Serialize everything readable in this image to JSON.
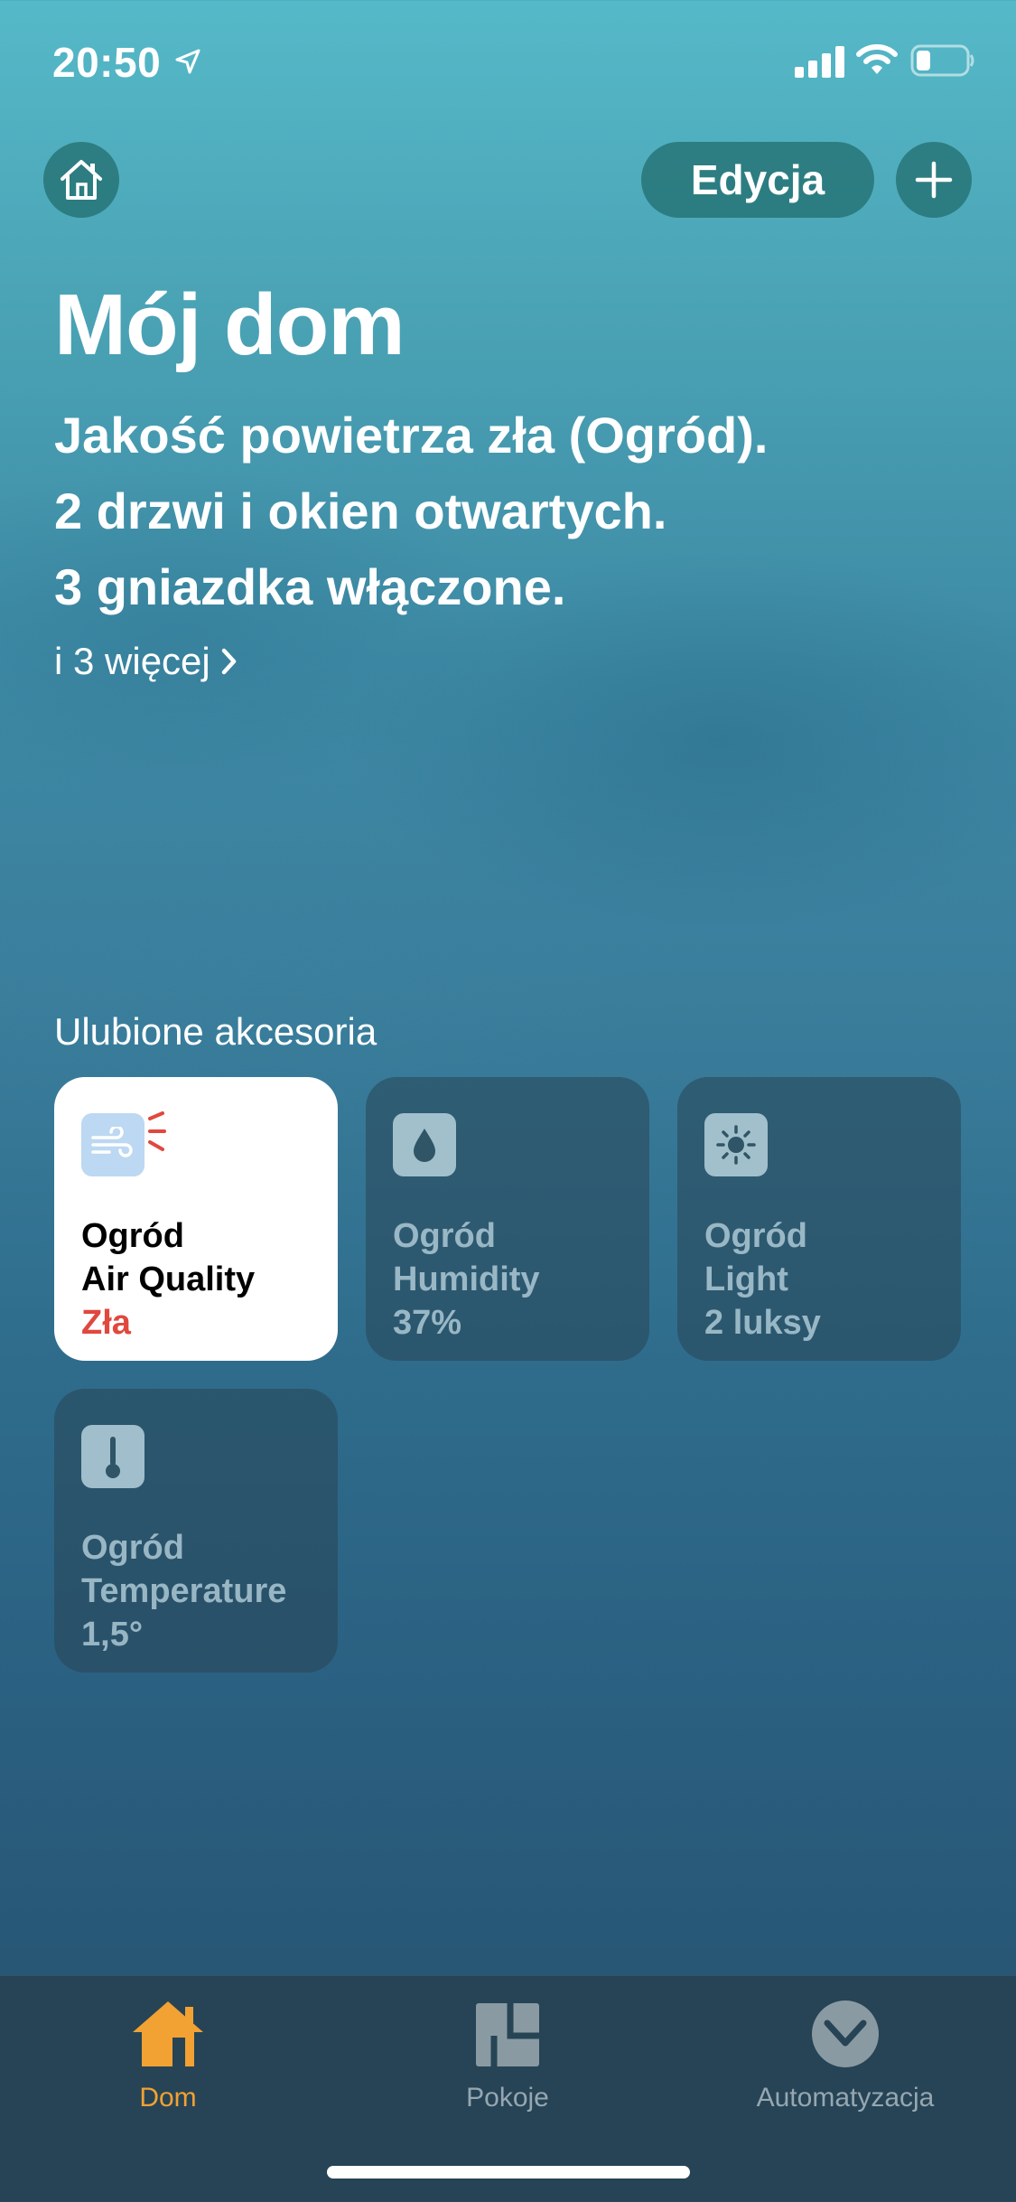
{
  "status_bar": {
    "time": "20:50",
    "icons": [
      "location-arrow-icon",
      "cellular-signal-icon",
      "wifi-icon",
      "battery-low-icon"
    ]
  },
  "header": {
    "home_icon": "house-icon",
    "edit_label": "Edycja",
    "add_icon": "plus-icon"
  },
  "title": "Mój dom",
  "summary": [
    "Jakość powietrza zła (Ogród).",
    "2 drzwi i okien otwartych.",
    "3 gniazdka włączone."
  ],
  "more_link": "i 3 więcej",
  "favorites": {
    "title": "Ulubione akcesoria",
    "tiles": [
      {
        "room": "Ogród",
        "name": "Air Quality",
        "status": "Zła",
        "icon": "wind-icon",
        "active": true
      },
      {
        "room": "Ogród",
        "name": "Humidity",
        "status": "37%",
        "icon": "droplet-icon",
        "active": false
      },
      {
        "room": "Ogród",
        "name": "Light",
        "status": "2 luksy",
        "icon": "sun-icon",
        "active": false
      },
      {
        "room": "Ogród",
        "name": "Temperature",
        "status": "1,5°",
        "icon": "thermometer-icon",
        "active": false
      }
    ]
  },
  "tabs": [
    {
      "label": "Dom",
      "icon": "house-fill-icon",
      "selected": true
    },
    {
      "label": "Pokoje",
      "icon": "rooms-icon",
      "selected": false
    },
    {
      "label": "Automatyzacja",
      "icon": "clock-check-icon",
      "selected": false
    }
  ],
  "colors": {
    "accent": "#f2a133",
    "alert": "#e0483e",
    "tile_active_bg": "#ffffff"
  }
}
